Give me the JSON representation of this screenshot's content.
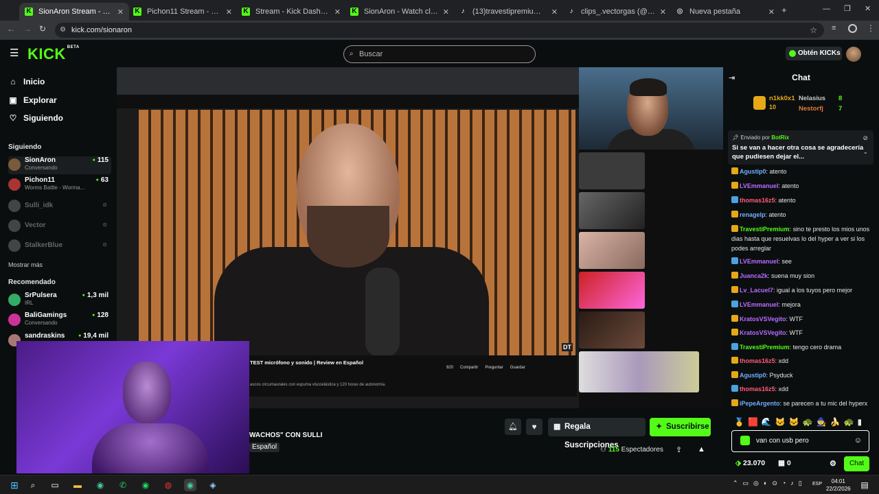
{
  "browser": {
    "tabs": [
      {
        "title": "SionAron Stream - Watch Live",
        "active": true,
        "favicon": "kick-icon"
      },
      {
        "title": "Pichon11 Stream - Watch Live o",
        "active": false,
        "favicon": "kick-icon"
      },
      {
        "title": "Stream - Kick Dashboard",
        "active": false,
        "favicon": "kick-icon"
      },
      {
        "title": "SionAron - Watch clips on Kick",
        "active": false,
        "favicon": "kick-icon"
      },
      {
        "title": "(13)travestipremium (@travestipr",
        "active": false,
        "favicon": "tiktok-icon"
      },
      {
        "title": "clips_.vectorgas (@clips_.vecto",
        "active": false,
        "favicon": "tiktok-icon"
      },
      {
        "title": "Nueva pestaña",
        "active": false,
        "favicon": "chrome-icon"
      }
    ],
    "url": "kick.com/sionaron"
  },
  "header": {
    "logo": "KICK",
    "logo_sup": "BETA",
    "search_placeholder": "Buscar",
    "get_kicks": "Obtén KICKs"
  },
  "sidebar": {
    "nav": [
      {
        "label": "Inicio",
        "icon": "home-icon"
      },
      {
        "label": "Explorar",
        "icon": "compass-icon"
      },
      {
        "label": "Siguiendo",
        "icon": "heart-icon"
      }
    ],
    "following_title": "Siguiendo",
    "following": [
      {
        "name": "SionAron",
        "sub": "Conversando",
        "viewers": "115",
        "live": true,
        "color": "#7a5a3a"
      },
      {
        "name": "Pichon11",
        "sub": "Worms Battle - Worma...",
        "viewers": "63",
        "live": true,
        "color": "#a33"
      },
      {
        "name": "Sulli_idk",
        "sub": "",
        "viewers": "",
        "live": false,
        "color": "#888"
      },
      {
        "name": "Vector",
        "sub": "",
        "viewers": "",
        "live": false,
        "color": "#888"
      },
      {
        "name": "StalkerBlue",
        "sub": "",
        "viewers": "",
        "live": false,
        "color": "#888"
      }
    ],
    "show_more": "Mostrar más",
    "recommended_title": "Recomendado",
    "recommended": [
      {
        "name": "SrPulsera",
        "sub": "IRL",
        "viewers": "1,3 mil",
        "color": "#3a6"
      },
      {
        "name": "BaliGamings",
        "sub": "Conversando",
        "viewers": "128",
        "color": "#c39"
      },
      {
        "name": "sandraskins",
        "sub": "",
        "viewers": "19,4 mil",
        "color": "#a77"
      }
    ]
  },
  "video": {
    "yt_title": "TEST micrófono y sonido | Review en Español",
    "yt_desc": "ascos circumaurales con espuma viscoelástica y 120 horas de autonomía.",
    "yt_likes": "920",
    "yt_share": "Compartir",
    "yt_ask": "Preguntar",
    "yt_save": "Guardar",
    "watermark": "DT"
  },
  "stream": {
    "title": "WACHOS\" CON SULLI",
    "language": "Español",
    "gift_label": "Regala Suscripciones",
    "subscribe_label": "Suscribirse",
    "viewers": "115",
    "viewers_label": "Espectadores"
  },
  "chat": {
    "title": "Chat",
    "top_gifters": [
      {
        "name": "n1kk0x1",
        "count": "10",
        "color": "#e6a817"
      },
      {
        "name": "Nelasius",
        "count": "8",
        "color": "#c9c9c9"
      },
      {
        "name": "Nestorfj",
        "count": "7",
        "color": "#e07b39"
      }
    ],
    "pinned_by_label": "Enviado por",
    "pinned_by": "BotRix",
    "pinned_text": "Si se van a hacer otra cosa se agradecería que pudiesen dejar el...",
    "messages": [
      {
        "user": "Agustip0",
        "color": "#6fb1ff",
        "text": "atento"
      },
      {
        "user": "LVEmmanuel",
        "color": "#b86bff",
        "text": "atento"
      },
      {
        "user": "thomas16z5",
        "color": "#ff5b7a",
        "text": "atento"
      },
      {
        "user": "renagelp",
        "color": "#6fb1ff",
        "text": "atento"
      },
      {
        "user": "TravestiPremium",
        "color": "#53fc18",
        "text": "sino te presto los mios unos dias hasta que resuelvas lo del hyper a ver si los podes arreglar"
      },
      {
        "user": "LVEmmanuel",
        "color": "#b86bff",
        "text": "see"
      },
      {
        "user": "Juanca2k",
        "color": "#b86bff",
        "text": "suena muy sion"
      },
      {
        "user": "Lv_Lacuel7",
        "color": "#b86bff",
        "text": "igual a los tuyos pero mejor"
      },
      {
        "user": "LVEmmanuel",
        "color": "#b86bff",
        "text": "mejora"
      },
      {
        "user": "KratosVSVegito",
        "color": "#b86bff",
        "text": "WTF"
      },
      {
        "user": "KratosVSVegito",
        "color": "#b86bff",
        "text": "WTF"
      },
      {
        "user": "TravestiPremium",
        "color": "#53fc18",
        "text": "tengo cero drama"
      },
      {
        "user": "thomas16z5",
        "color": "#ff5b7a",
        "text": "xdd"
      },
      {
        "user": "Agustip0",
        "color": "#6fb1ff",
        "text": "Psyduck"
      },
      {
        "user": "thomas16z5",
        "color": "#ff5b7a",
        "text": "xdd"
      },
      {
        "user": "iPepeArgento",
        "color": "#6fb1ff",
        "text": "se parecen a tu mic del hyperx"
      }
    ],
    "input_value": "van con usb pero",
    "kicks": "23.070",
    "gifts": "0",
    "send_label": "Chat"
  },
  "taskbar": {
    "lang": "ESP",
    "time": "04:01",
    "date": "22/2/2026"
  }
}
